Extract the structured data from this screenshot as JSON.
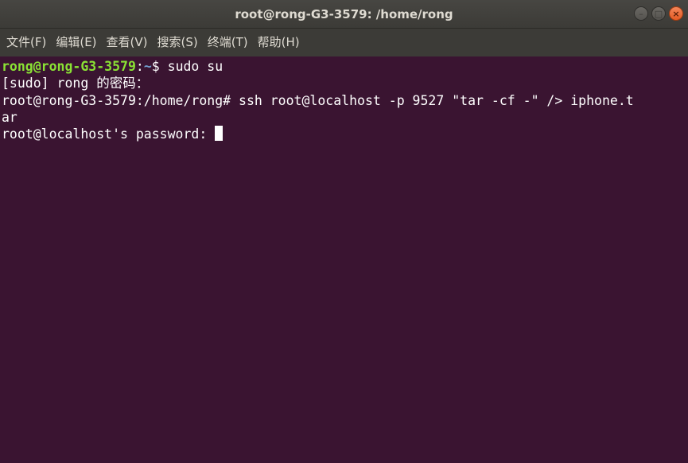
{
  "window": {
    "title": "root@rong-G3-3579: /home/rong"
  },
  "controls": {
    "minimize_icon": "minimize-icon",
    "maximize_icon": "maximize-icon",
    "close_icon": "close-icon"
  },
  "menubar": {
    "items": [
      {
        "label": "文件(F)"
      },
      {
        "label": "编辑(E)"
      },
      {
        "label": "查看(V)"
      },
      {
        "label": "搜索(S)"
      },
      {
        "label": "终端(T)"
      },
      {
        "label": "帮助(H)"
      }
    ]
  },
  "terminal": {
    "line1": {
      "user_host": "rong@rong-G3-3579",
      "sep": ":",
      "path": "~",
      "command": "$ sudo su"
    },
    "line2": "[sudo] rong 的密码：",
    "line3": "root@rong-G3-3579:/home/rong# ssh root@localhost -p 9527 \"tar -cf -\" /> iphone.t",
    "line4": "ar",
    "line5": "root@localhost's password: "
  },
  "colors": {
    "background": "#3a1431",
    "prompt_user": "#8ae234",
    "prompt_path": "#729fcf",
    "text": "#ffffff",
    "titlebar": "#3c3b37",
    "close_button": "#e95420"
  }
}
